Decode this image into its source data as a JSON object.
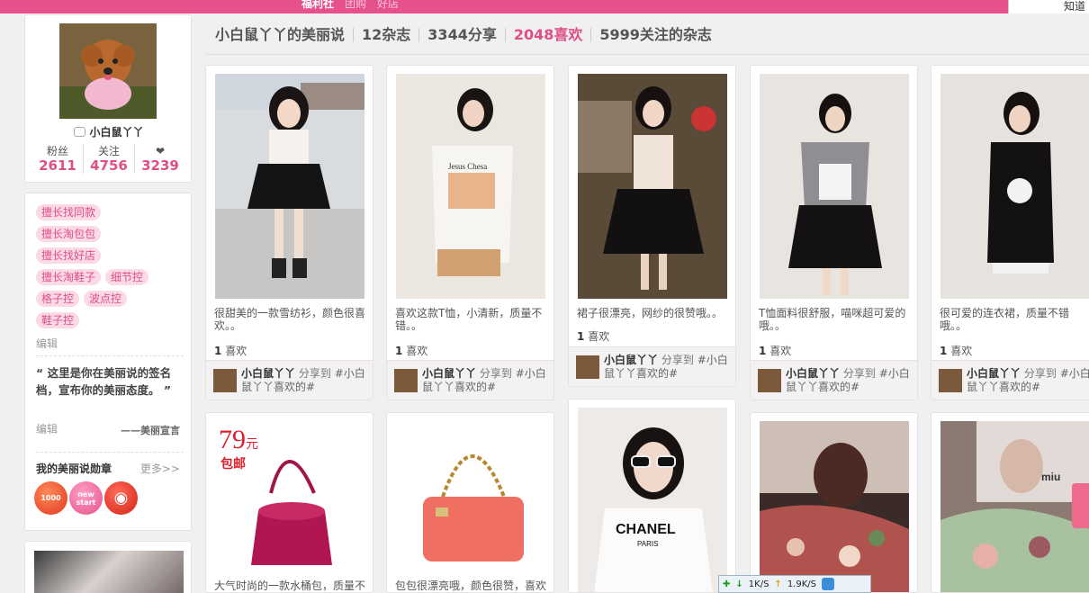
{
  "topnav": {
    "items": [
      "福利社",
      "团购",
      "好店"
    ],
    "search_text": "知道"
  },
  "header": {
    "title": "小白鼠丫丫的美丽说",
    "magazines": "12杂志",
    "shares": "3344分享",
    "likes": "2048喜欢",
    "following": "5999关注的杂志"
  },
  "profile": {
    "username": "小白鼠丫丫",
    "stats": [
      {
        "label": "粉丝",
        "value": "2611"
      },
      {
        "label": "关注",
        "value": "4756"
      },
      {
        "label": "❤",
        "value": "3239"
      }
    ]
  },
  "tags": [
    "擅长找同款",
    "擅长淘包包",
    "擅长找好店",
    "擅长淘鞋子",
    "细节控",
    "格子控",
    "波点控",
    "鞋子控"
  ],
  "edit_label": "编辑",
  "motto": {
    "text": "“ 这里是你在美丽说的签名档，宣布你的美丽态度。 ”",
    "signature": "——美丽宣言"
  },
  "badges": {
    "title": "我的美丽说勋章",
    "more": "更多>>",
    "items": [
      "1000",
      "new start",
      ""
    ]
  },
  "cards": [
    {
      "desc": "很甜美的一款雪纺衫，颜色很喜欢。。",
      "likes_num": "1",
      "likes_label": "喜欢"
    },
    {
      "desc": "喜欢这款T恤，小清新，质量不错。。",
      "likes_num": "1",
      "likes_label": "喜欢"
    },
    {
      "desc": "裙子很漂亮，网纱的很赞哦。。",
      "likes_num": "1",
      "likes_label": "喜欢"
    },
    {
      "desc": "T恤面料很舒服，喵咪超可爱的哦。。",
      "likes_num": "1",
      "likes_label": "喜欢"
    },
    {
      "desc": "很可爱的连衣裙，质量不错哦。。",
      "likes_num": "1",
      "likes_label": "喜欢"
    }
  ],
  "share": {
    "user": "小白鼠丫丫",
    "action": "分享到",
    "target": "#小白鼠丫丫喜欢的#"
  },
  "row2": [
    {
      "desc": "大气时尚的一款水桶包，质量不",
      "price": "79",
      "price_unit": "元",
      "price_sub": "包邮"
    },
    {
      "desc": "包包很漂亮哦，颜色很赞，喜欢"
    },
    {
      "desc": ""
    },
    {
      "desc": ""
    },
    {
      "desc": ""
    }
  ],
  "netbar": {
    "down": "1K/S",
    "up": "1.9K/S"
  }
}
